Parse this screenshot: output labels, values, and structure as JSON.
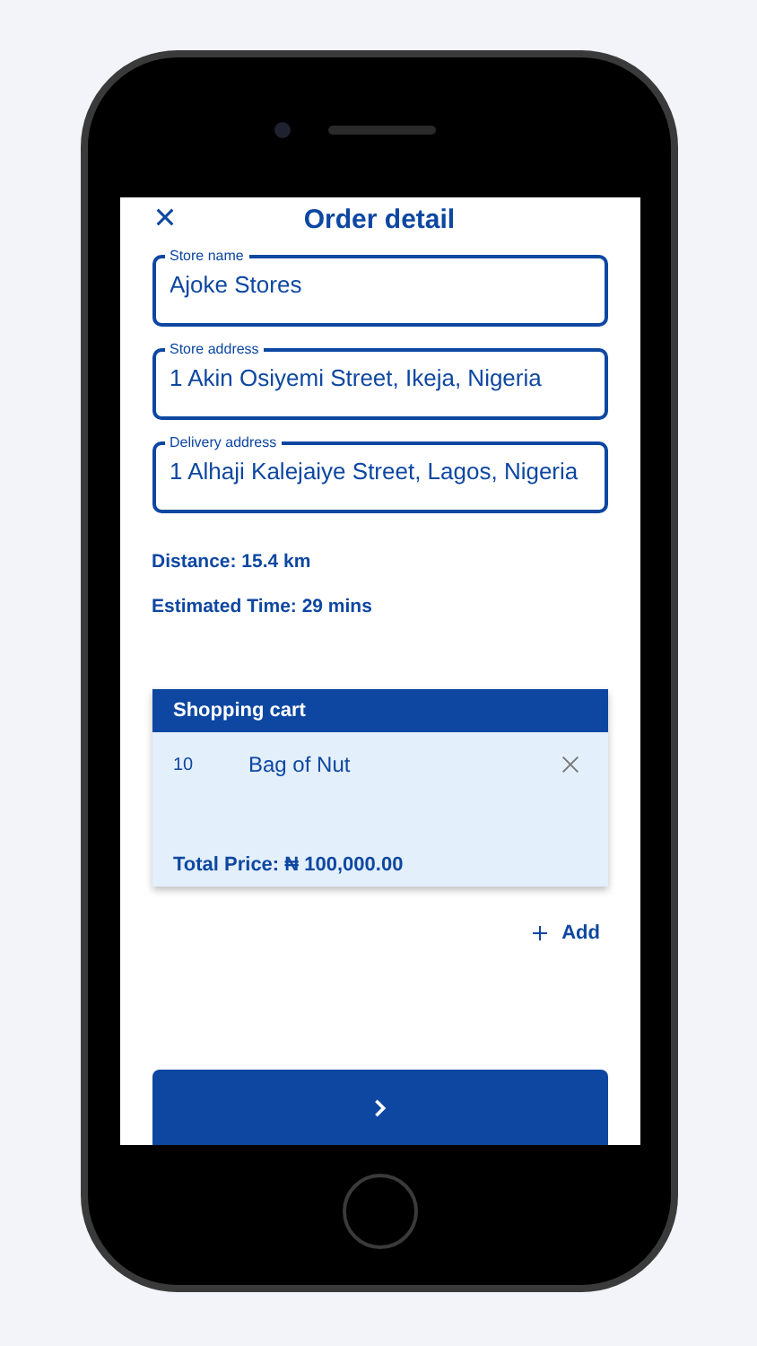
{
  "header": {
    "title": "Order detail"
  },
  "fields": [
    {
      "label": "Store name",
      "value": "Ajoke Stores"
    },
    {
      "label": "Store address",
      "value": "1 Akin Osiyemi Street, Ikeja, Nigeria"
    },
    {
      "label": "Delivery address",
      "value": "1 Alhaji Kalejaiye Street, Lagos, Nigeria"
    }
  ],
  "distance": "Distance: 15.4 km",
  "estimated_time": "Estimated Time: 29 mins",
  "cart": {
    "title": "Shopping cart",
    "items": [
      {
        "quantity": "10",
        "name": "Bag of Nut"
      }
    ],
    "total": "Total Price: ₦ 100,000.00"
  },
  "add_link": "Add"
}
